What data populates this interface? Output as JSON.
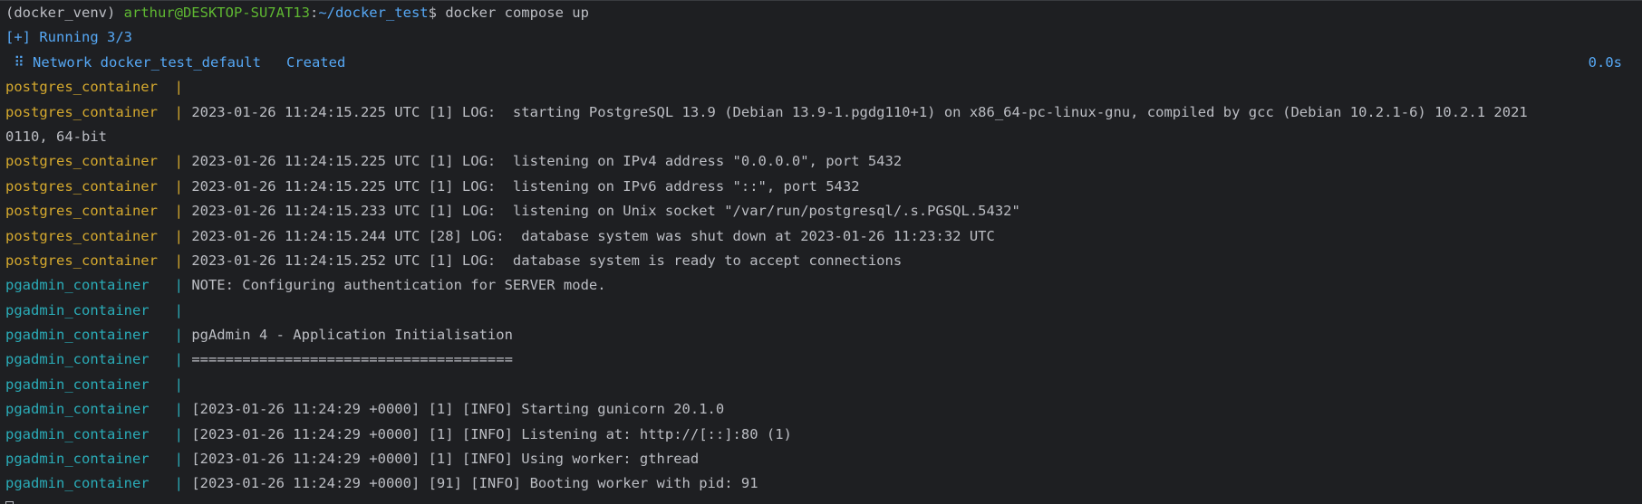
{
  "prompt": {
    "venv": "(docker_venv) ",
    "user_host": "arthur@DESKTOP-SU7AT13",
    "colon": ":",
    "path": "~/docker_test",
    "dollar": "$ ",
    "command": "docker compose up"
  },
  "running": "[+] Running 3/3",
  "network": {
    "text": " ⠿ Network docker_test_default   Created",
    "time": "0.0s"
  },
  "logs": [
    {
      "service": "postgres_container  ",
      "sep": "| ",
      "msg": "",
      "kind": "postgres"
    },
    {
      "service": "postgres_container  ",
      "sep": "| ",
      "msg": "2023-01-26 11:24:15.225 UTC [1] LOG:  starting PostgreSQL 13.9 (Debian 13.9-1.pgdg110+1) on x86_64-pc-linux-gnu, compiled by gcc (Debian 10.2.1-6) 10.2.1 2021",
      "kind": "postgres"
    },
    {
      "service": "",
      "sep": "",
      "msg": "0110, 64-bit",
      "kind": "plain"
    },
    {
      "service": "postgres_container  ",
      "sep": "| ",
      "msg": "2023-01-26 11:24:15.225 UTC [1] LOG:  listening on IPv4 address \"0.0.0.0\", port 5432",
      "kind": "postgres"
    },
    {
      "service": "postgres_container  ",
      "sep": "| ",
      "msg": "2023-01-26 11:24:15.225 UTC [1] LOG:  listening on IPv6 address \"::\", port 5432",
      "kind": "postgres"
    },
    {
      "service": "postgres_container  ",
      "sep": "| ",
      "msg": "2023-01-26 11:24:15.233 UTC [1] LOG:  listening on Unix socket \"/var/run/postgresql/.s.PGSQL.5432\"",
      "kind": "postgres"
    },
    {
      "service": "postgres_container  ",
      "sep": "| ",
      "msg": "2023-01-26 11:24:15.244 UTC [28] LOG:  database system was shut down at 2023-01-26 11:23:32 UTC",
      "kind": "postgres"
    },
    {
      "service": "postgres_container  ",
      "sep": "| ",
      "msg": "2023-01-26 11:24:15.252 UTC [1] LOG:  database system is ready to accept connections",
      "kind": "postgres"
    },
    {
      "service": "pgadmin_container   ",
      "sep": "| ",
      "msg": "NOTE: Configuring authentication for SERVER mode.",
      "kind": "pgadmin"
    },
    {
      "service": "pgadmin_container   ",
      "sep": "| ",
      "msg": "",
      "kind": "pgadmin"
    },
    {
      "service": "pgadmin_container   ",
      "sep": "| ",
      "msg": "pgAdmin 4 - Application Initialisation",
      "kind": "pgadmin"
    },
    {
      "service": "pgadmin_container   ",
      "sep": "| ",
      "msg": "======================================",
      "kind": "pgadmin"
    },
    {
      "service": "pgadmin_container   ",
      "sep": "| ",
      "msg": "",
      "kind": "pgadmin"
    },
    {
      "service": "pgadmin_container   ",
      "sep": "| ",
      "msg": "[2023-01-26 11:24:29 +0000] [1] [INFO] Starting gunicorn 20.1.0",
      "kind": "pgadmin"
    },
    {
      "service": "pgadmin_container   ",
      "sep": "| ",
      "msg": "[2023-01-26 11:24:29 +0000] [1] [INFO] Listening at: http://[::]:80 (1)",
      "kind": "pgadmin"
    },
    {
      "service": "pgadmin_container   ",
      "sep": "| ",
      "msg": "[2023-01-26 11:24:29 +0000] [1] [INFO] Using worker: gthread",
      "kind": "pgadmin"
    },
    {
      "service": "pgadmin_container   ",
      "sep": "| ",
      "msg": "[2023-01-26 11:24:29 +0000] [91] [INFO] Booting worker with pid: 91",
      "kind": "pgadmin"
    }
  ],
  "colors": {
    "background": "#1e1f22",
    "text": "#bcbec4",
    "green": "#5fb832",
    "blue": "#56a8f5",
    "postgres": "#d5a92e",
    "pgadmin": "#2aacb8"
  }
}
